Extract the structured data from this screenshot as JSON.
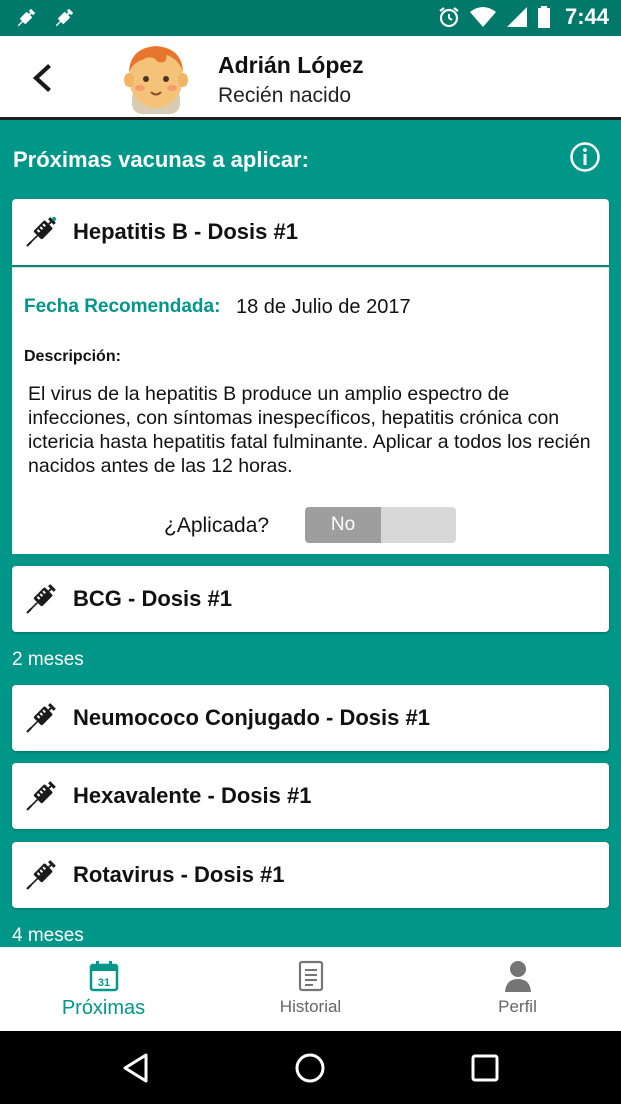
{
  "status_bar": {
    "time": "7:44",
    "left_icons": [
      "syringe-notification-icon",
      "syringe-notification-icon"
    ],
    "right_icons": [
      "alarm-icon",
      "wifi-icon",
      "signal-icon",
      "battery-icon"
    ]
  },
  "header": {
    "name": "Adrián López",
    "subtitle": "Recién nacido"
  },
  "main": {
    "section_title": "Próximas vacunas a aplicar:",
    "expanded_vaccine": {
      "title": "Hepatitis B - Dosis #1",
      "fecha_label": "Fecha Recomendada:",
      "fecha_value": "18 de Julio de 2017",
      "desc_label": "Descripción:",
      "desc_text": "El virus de la hepatitis B produce un amplio espectro de infecciones, con síntomas inespecíficos, hepatitis crónica con ictericia hasta hepatitis fatal fulminante. Aplicar a todos los recién nacidos antes de las 12 horas.",
      "applied_label": "¿Aplicada?",
      "applied_value": "No"
    },
    "newborn_vaccines": [
      {
        "title": "BCG - Dosis #1"
      }
    ],
    "group_2m": {
      "label": "2 meses",
      "vaccines": [
        {
          "title": "Neumococo Conjugado - Dosis #1"
        },
        {
          "title": "Hexavalente - Dosis #1"
        },
        {
          "title": "Rotavirus - Dosis #1"
        }
      ]
    },
    "group_4m": {
      "label": "4 meses"
    }
  },
  "bottom_nav": {
    "proximas": "Próximas",
    "historial": "Historial",
    "perfil": "Perfil",
    "calendar_day": "31"
  },
  "colors": {
    "primary": "#009688",
    "primary_dark": "#00796b",
    "toggle_off": "#9e9e9e"
  }
}
